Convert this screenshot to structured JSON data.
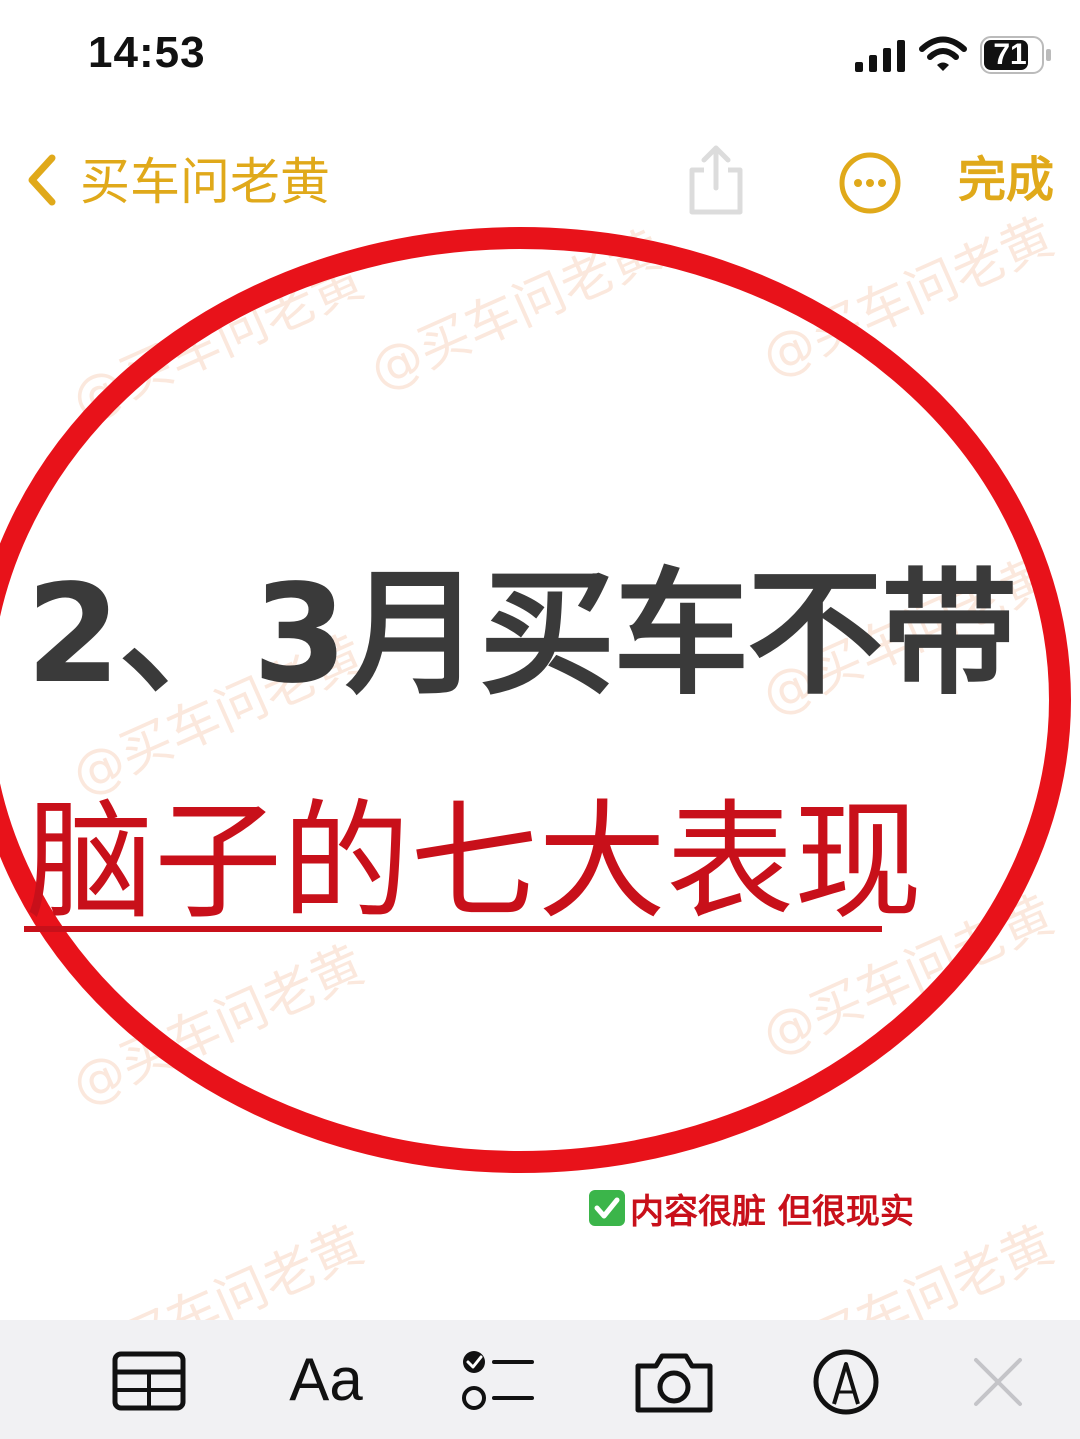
{
  "status_bar": {
    "time": "14:53",
    "battery": "71",
    "icons": [
      "signal-icon",
      "wifi-icon",
      "battery-icon"
    ]
  },
  "nav": {
    "back_label": "买车问老黄",
    "done_label": "完成",
    "icons": [
      "chevron-left-icon",
      "share-icon",
      "more-icon"
    ],
    "accent_color": "#e0a91a"
  },
  "watermark": "@买车问老黄",
  "headline": {
    "line1": "2、3月买车不带",
    "line2": "脑子的七大表现",
    "line1_color": "#3a3a3a",
    "line2_color": "#c8101a"
  },
  "tagline": "内容很脏 但很现实",
  "toolbar": {
    "format_label": "Aa",
    "icons": [
      "table-icon",
      "format-icon",
      "checklist-icon",
      "camera-icon",
      "markup-icon",
      "close-icon"
    ]
  }
}
